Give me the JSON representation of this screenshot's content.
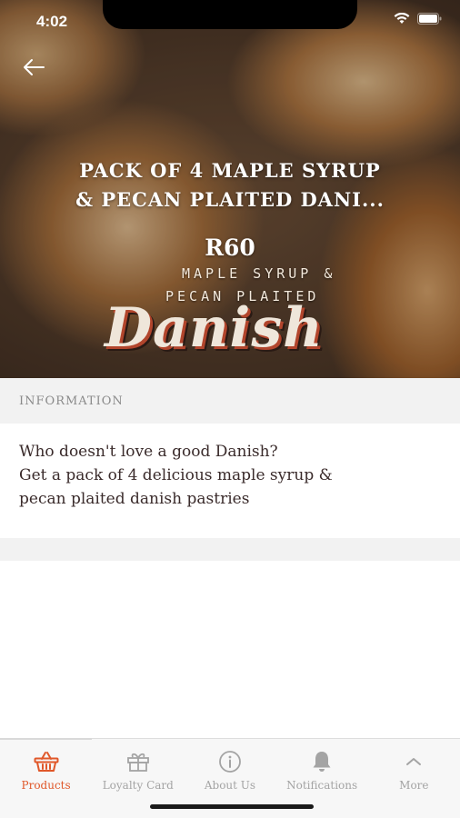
{
  "status_bar": {
    "time": "4:02"
  },
  "product": {
    "title_line1": "PACK OF 4 MAPLE SYRUP",
    "title_line2": "& PECAN PLAITED DANI...",
    "price": "R60",
    "image_text": {
      "line1": "MAPLE SYRUP &",
      "line2": "PECAN PLAITED",
      "script": "Danish"
    }
  },
  "information": {
    "header": "INFORMATION",
    "lines": [
      "Who doesn't love a good Danish?",
      "Get a pack of 4 delicious maple syrup &",
      "pecan plaited danish pastries"
    ]
  },
  "tabs": [
    {
      "label": "Products",
      "icon": "basket-icon",
      "active": true
    },
    {
      "label": "Loyalty Card",
      "icon": "gift-icon",
      "active": false
    },
    {
      "label": "About Us",
      "icon": "info-icon",
      "active": false
    },
    {
      "label": "Notifications",
      "icon": "bell-icon",
      "active": false
    },
    {
      "label": "More",
      "icon": "chevron-up-icon",
      "active": false
    }
  ],
  "colors": {
    "accent": "#e0582a",
    "inactive": "#a4a4a4",
    "tab_bar_bg": "#f7f7f7",
    "section_bg": "#f2f2f2"
  }
}
